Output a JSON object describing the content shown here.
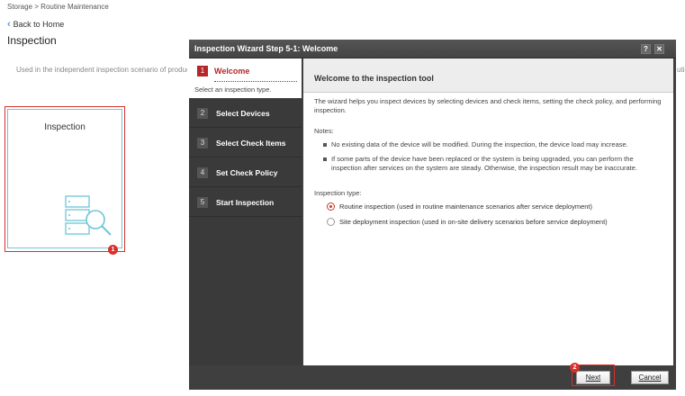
{
  "breadcrumb": {
    "root": "Storage",
    "separator": ">",
    "current": "Routine Maintenance"
  },
  "back_link": "Back to Home",
  "page_title": "Inspection",
  "page_description": "Used in the independent inspection scenario of products su",
  "page_description_tail": "utio",
  "card": {
    "title": "Inspection",
    "icon": "server-search-icon"
  },
  "annotations": {
    "badge1": "1",
    "badge2": "2",
    "accent": "#d9302c"
  },
  "dialog": {
    "title": "Inspection Wizard Step 5-1: Welcome",
    "help_label": "?",
    "close_label": "✕",
    "steps": [
      {
        "num": "1",
        "label": "Welcome",
        "sub": "Select an inspection type."
      },
      {
        "num": "2",
        "label": "Select Devices"
      },
      {
        "num": "3",
        "label": "Select Check Items"
      },
      {
        "num": "4",
        "label": "Set Check Policy"
      },
      {
        "num": "5",
        "label": "Start Inspection"
      }
    ],
    "content": {
      "title": "Welcome to the inspection tool",
      "intro": "The wizard helps you inspect devices by selecting devices and check items, setting the check policy, and performing inspection.",
      "notes_label": "Notes:",
      "notes": [
        "No existing data of the device will be modified. During the inspection, the device load may increase.",
        "If some parts of the device have been replaced or the system is being upgraded, you can perform the inspection after services on the system are steady. Otherwise, the inspection result may be inaccurate."
      ],
      "type_label": "Inspection type:",
      "options": [
        {
          "label": "Routine inspection (used in routine maintenance scenarios after service deployment)",
          "selected": true
        },
        {
          "label": "Site deployment inspection (used in on-site delivery scenarios before service deployment)",
          "selected": false
        }
      ]
    },
    "buttons": {
      "next": "Next",
      "cancel": "Cancel"
    }
  }
}
